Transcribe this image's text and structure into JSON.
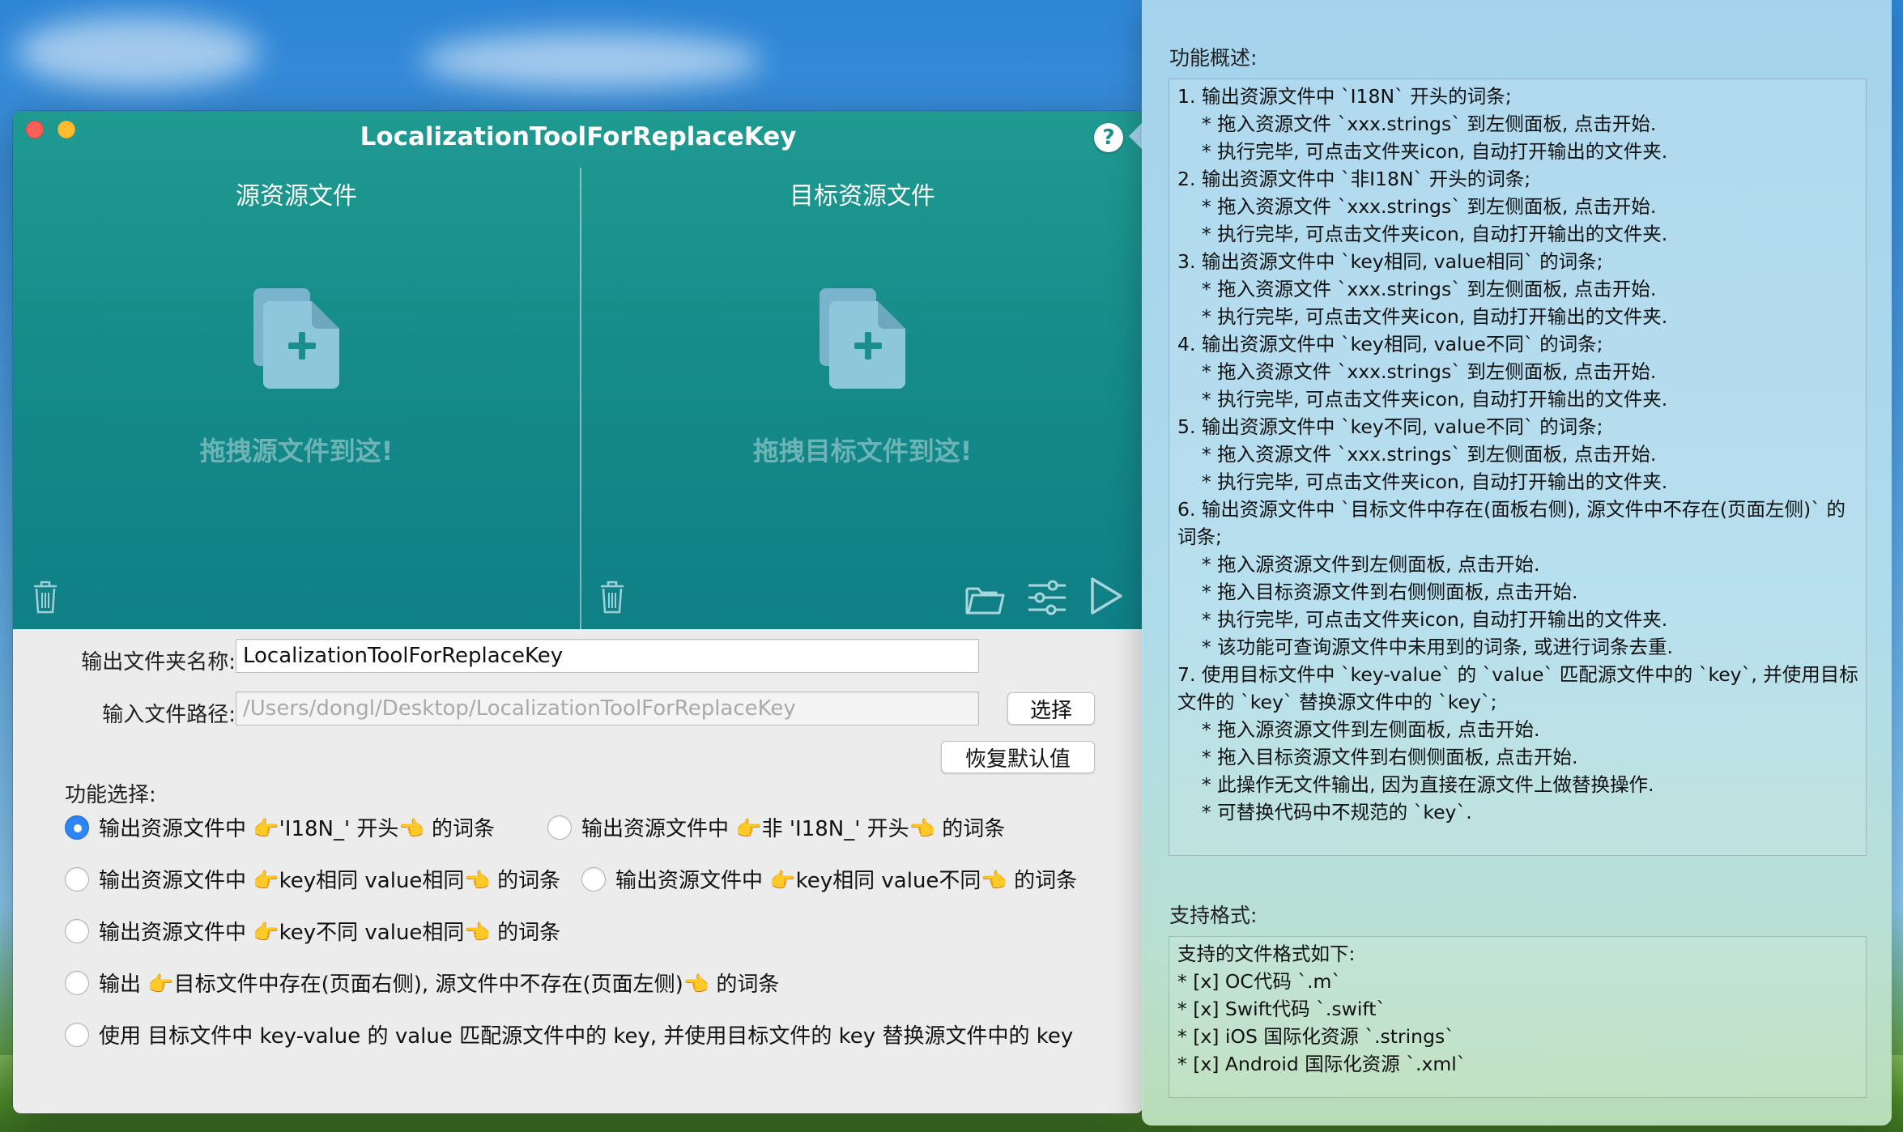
{
  "window": {
    "title": "LocalizationToolForReplaceKey",
    "help_label": "?"
  },
  "source_panel": {
    "title": "源资源文件",
    "drop_text": "拖拽源文件到这!"
  },
  "target_panel": {
    "title": "目标资源文件",
    "drop_text": "拖拽目标文件到这!"
  },
  "form": {
    "output_folder_label": "输出文件夹名称:",
    "output_folder_value": "LocalizationToolForReplaceKey",
    "input_path_label": "输入文件路径:",
    "input_path_value": "/Users/dongl/Desktop/LocalizationToolForReplaceKey",
    "choose_button": "选择",
    "reset_button": "恢复默认值",
    "function_label": "功能选择:"
  },
  "options": [
    {
      "label": "输出资源文件中 👉'I18N_' 开头👈 的词条",
      "selected": true
    },
    {
      "label": "输出资源文件中 👉非 'I18N_' 开头👈 的词条",
      "selected": false
    },
    {
      "label": "输出资源文件中 👉key相同  value相同👈 的词条",
      "selected": false
    },
    {
      "label": "输出资源文件中 👉key相同  value不同👈 的词条",
      "selected": false
    },
    {
      "label": "输出资源文件中 👉key不同  value相同👈 的词条",
      "selected": false
    },
    {
      "label": "输出 👉目标文件中存在(页面右侧), 源文件中不存在(页面左侧)👈 的词条",
      "selected": false
    },
    {
      "label": "使用 目标文件中 key-value 的 value 匹配源文件中的 key, 并使用目标文件的 key 替换源文件中的 key",
      "selected": false
    }
  ],
  "popover": {
    "overview_heading": "功能概述:",
    "overview_lines": [
      "1. 输出资源文件中 `I18N` 开头的词条;",
      "    * 拖入资源文件 `xxx.strings` 到左侧面板, 点击开始.",
      "    * 执行完毕, 可点击文件夹icon, 自动打开输出的文件夹.",
      "2. 输出资源文件中 `非I18N` 开头的词条;",
      "    * 拖入资源文件 `xxx.strings` 到左侧面板, 点击开始.",
      "    * 执行完毕, 可点击文件夹icon, 自动打开输出的文件夹.",
      "3. 输出资源文件中 `key相同, value相同` 的词条;",
      "    * 拖入资源文件 `xxx.strings` 到左侧面板, 点击开始.",
      "    * 执行完毕, 可点击文件夹icon, 自动打开输出的文件夹.",
      "4. 输出资源文件中 `key相同, value不同` 的词条;",
      "    * 拖入资源文件 `xxx.strings` 到左侧面板, 点击开始.",
      "    * 执行完毕, 可点击文件夹icon, 自动打开输出的文件夹.",
      "5. 输出资源文件中 `key不同, value不同` 的词条;",
      "    * 拖入资源文件 `xxx.strings` 到左侧面板, 点击开始.",
      "    * 执行完毕, 可点击文件夹icon, 自动打开输出的文件夹.",
      "6. 输出资源文件中 `目标文件中存在(面板右侧), 源文件中不存在(页面左侧)` 的",
      "词条;",
      "    * 拖入源资源文件到左侧面板, 点击开始.",
      "    * 拖入目标资源文件到右侧侧面板, 点击开始.",
      "    * 执行完毕, 可点击文件夹icon, 自动打开输出的文件夹.",
      "    * 该功能可查询源文件中未用到的词条, 或进行词条去重.",
      "7. 使用目标文件中 `key-value` 的 `value` 匹配源文件中的 `key`, 并使用目标",
      "文件的 `key` 替换源文件中的 `key`;",
      "    * 拖入源资源文件到左侧面板, 点击开始.",
      "    * 拖入目标资源文件到右侧侧面板, 点击开始.",
      "    * 此操作无文件输出, 因为直接在源文件上做替换操作.",
      "    * 可替换代码中不规范的 `key`."
    ],
    "formats_heading": "支持格式:",
    "formats_lines": [
      "支持的文件格式如下:",
      "* [x] OC代码 `.m`",
      "* [x] Swift代码 `.swift`",
      "* [x] iOS 国际化资源 `.strings`",
      "* [x] Android 国际化资源 `.xml`"
    ]
  }
}
